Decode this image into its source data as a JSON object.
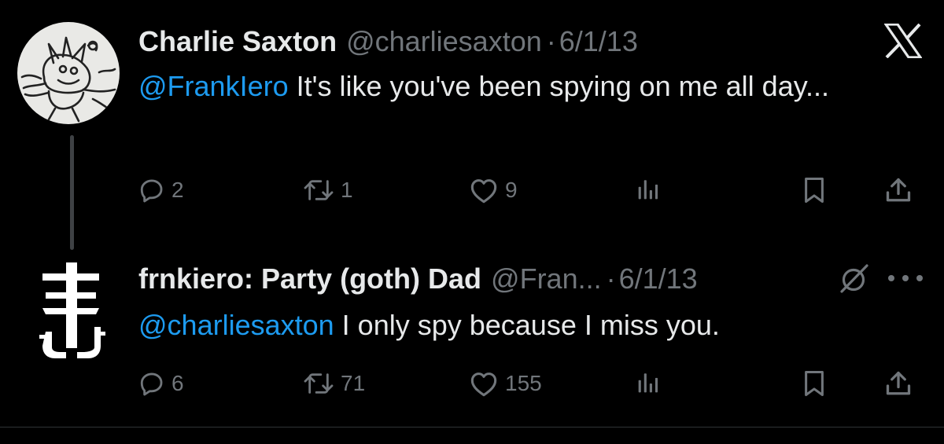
{
  "tweets": [
    {
      "display_name": "Charlie Saxton",
      "handle": "@charliesaxton",
      "separator": "·",
      "date": "6/1/13",
      "mention": "@FrankIero",
      "text": " It's like you've been spying on me all day...",
      "avatar_icon": "sketch-avatar",
      "actions": {
        "replies": "2",
        "reposts": "1",
        "likes": "9"
      }
    },
    {
      "display_name": "frnkiero: Party (goth) Dad",
      "handle": "@Fran...",
      "separator": "·",
      "date": "6/1/13",
      "mention": "@charliesaxton",
      "text": " I only spy because I miss you.",
      "avatar_icon": "frankiero-logo",
      "actions": {
        "replies": "6",
        "reposts": "71",
        "likes": "155"
      }
    }
  ],
  "icons": {
    "brand": "x-logo",
    "grok": "grok-icon",
    "more": "more-dots-icon",
    "reply": "reply-icon",
    "repost": "repost-icon",
    "like": "like-icon",
    "views": "views-icon",
    "bookmark": "bookmark-icon",
    "share": "share-icon"
  },
  "colors": {
    "background": "#000000",
    "text": "#e7e9ea",
    "secondary": "#71767b",
    "link": "#1d9bf0",
    "thread_line": "#3e4144"
  }
}
